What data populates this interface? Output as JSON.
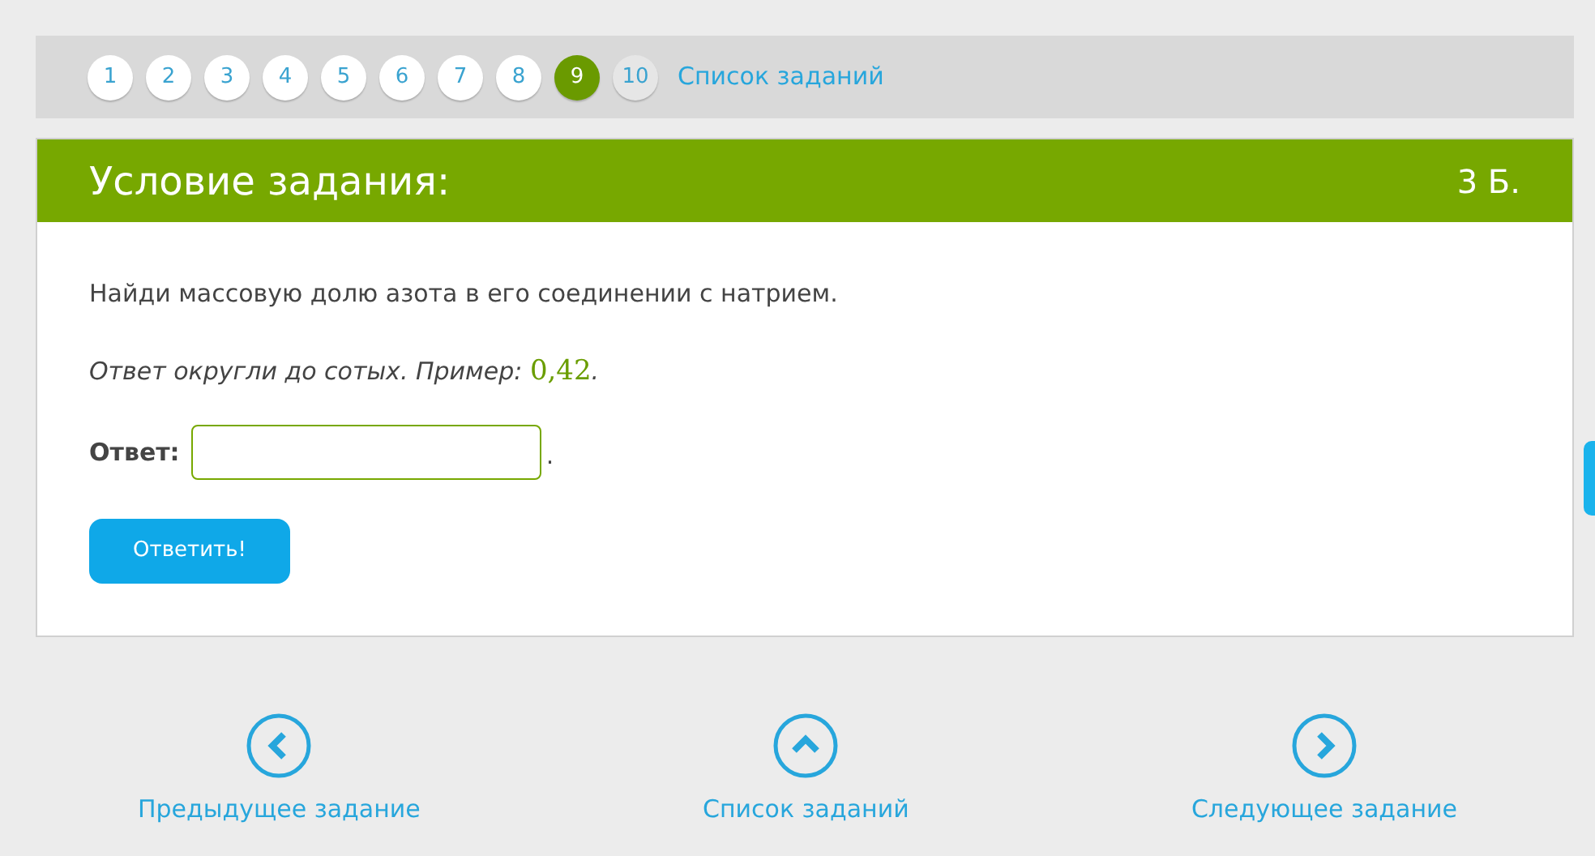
{
  "pager": {
    "pages": [
      {
        "label": "1",
        "selected": false,
        "disabled": false
      },
      {
        "label": "2",
        "selected": false,
        "disabled": false
      },
      {
        "label": "3",
        "selected": false,
        "disabled": false
      },
      {
        "label": "4",
        "selected": false,
        "disabled": false
      },
      {
        "label": "5",
        "selected": false,
        "disabled": false
      },
      {
        "label": "6",
        "selected": false,
        "disabled": false
      },
      {
        "label": "7",
        "selected": false,
        "disabled": false
      },
      {
        "label": "8",
        "selected": false,
        "disabled": false
      },
      {
        "label": "9",
        "selected": true,
        "disabled": false
      },
      {
        "label": "10",
        "selected": false,
        "disabled": true
      }
    ],
    "list_link": "Список заданий"
  },
  "task": {
    "title": "Условие задания:",
    "points": "3 Б.",
    "question": "Найди массовую долю азота в его соединении с натрием.",
    "hint": "Ответ округли до сотых. Пример:",
    "example": "0,42",
    "hint_end": ".",
    "answer_label": "Ответ:",
    "answer_end": ".",
    "submit": "Ответить!"
  },
  "nav": [
    {
      "kind": "prev",
      "label": "Предыдущее задание"
    },
    {
      "kind": "list",
      "label": "Список заданий"
    },
    {
      "kind": "next",
      "label": "Следующее задание"
    }
  ]
}
